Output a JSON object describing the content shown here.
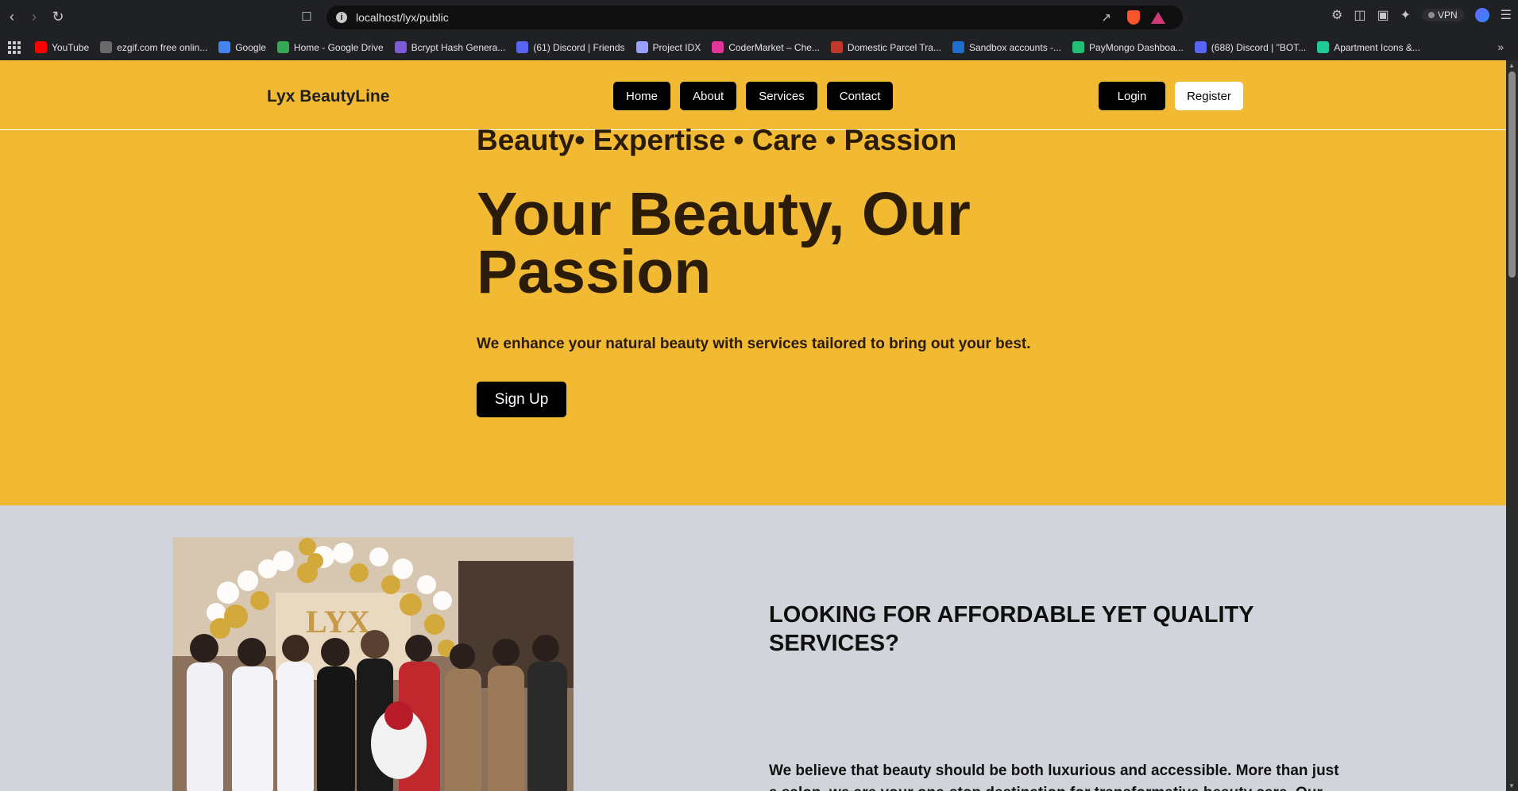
{
  "browser": {
    "url": "localhost/lyx/public",
    "vpn_label": "VPN",
    "bookmarks": [
      {
        "label": "YouTube",
        "color": "#ff0000"
      },
      {
        "label": "ezgif.com free onlin...",
        "color": "#6a6a6a"
      },
      {
        "label": "Google",
        "color": "#4285f4"
      },
      {
        "label": "Home - Google Drive",
        "color": "#34a853"
      },
      {
        "label": "Bcrypt Hash Genera...",
        "color": "#7b5cd6"
      },
      {
        "label": "(61) Discord | Friends",
        "color": "#5865f2"
      },
      {
        "label": "Project IDX",
        "color": "#9aa0ff"
      },
      {
        "label": "CoderMarket – Che...",
        "color": "#e0359a"
      },
      {
        "label": "Domestic Parcel Tra...",
        "color": "#c0392b"
      },
      {
        "label": "Sandbox accounts -...",
        "color": "#1f6fd1"
      },
      {
        "label": "PayMongo Dashboa...",
        "color": "#1fbf75"
      },
      {
        "label": "(688) Discord | \"BOT...",
        "color": "#5865f2"
      },
      {
        "label": "Apartment Icons &...",
        "color": "#20c997"
      }
    ],
    "more_label": "»"
  },
  "site": {
    "brand": "Lyx BeautyLine",
    "menu": [
      "Home",
      "About",
      "Services",
      "Contact"
    ],
    "login": "Login",
    "register": "Register",
    "accent_color": "#f2b933"
  },
  "hero": {
    "tagline": "Beauty• Expertise • Care • Passion",
    "headline": "Your Beauty, Our Passion",
    "subtext": "We enhance your natural beauty with services tailored to bring out your best.",
    "cta": "Sign Up"
  },
  "about": {
    "title": "LOOKING FOR AFFORDABLE YET QUALITY SERVICES?",
    "text": "We believe that beauty should be both luxurious and accessible. More than just a salon, we are your one-stop destination for transformative beauty care. Our expert"
  }
}
